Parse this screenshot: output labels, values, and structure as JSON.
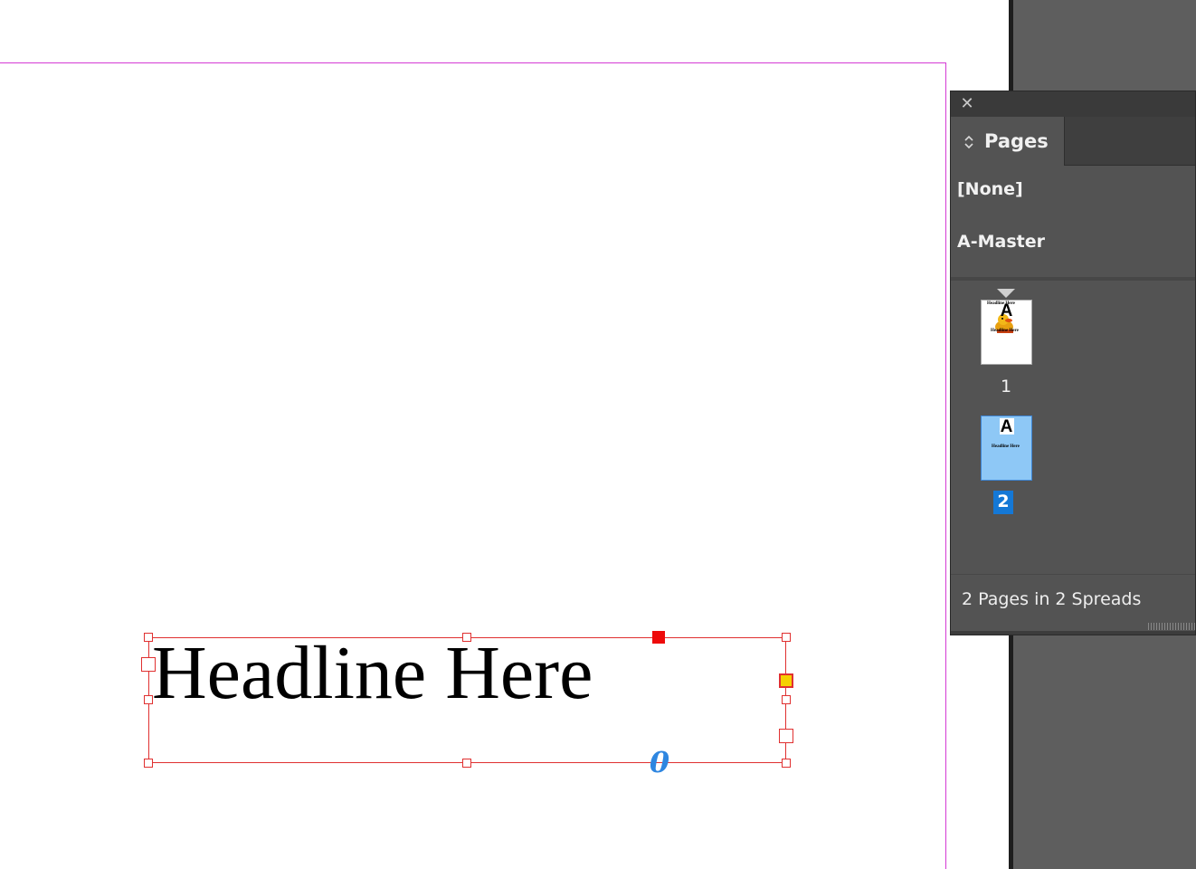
{
  "document": {
    "headline": "Headline Here",
    "fit_glyph": "0"
  },
  "panel": {
    "close_glyph": "✕",
    "tab_arrows": "⌃\n⌄",
    "tab_label": "Pages",
    "masters": [
      "[None]",
      "A-Master"
    ],
    "pages": [
      {
        "number": "1",
        "prefix": "A",
        "thumb_text": "Headline Here",
        "selected": false
      },
      {
        "number": "2",
        "prefix": "A",
        "thumb_text": "Headline Here",
        "selected": true
      }
    ],
    "status": "2 Pages in 2 Spreads"
  },
  "colors": {
    "frame_stroke": "#e03030",
    "page_margin": "#d43ad4",
    "selection_blue": "#1478d6",
    "thumb_selected_fill": "#8ec8f6",
    "panel_bg": "#535353"
  }
}
